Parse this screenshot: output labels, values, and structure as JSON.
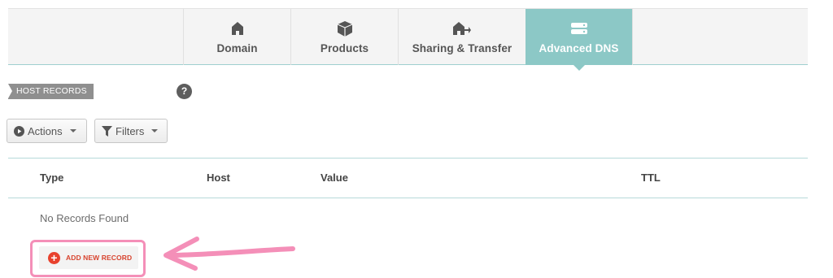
{
  "tabs": [
    {
      "label": "Domain",
      "icon": "home-icon",
      "active": false
    },
    {
      "label": "Products",
      "icon": "box-icon",
      "active": false
    },
    {
      "label": "Sharing & Transfer",
      "icon": "home-share-icon",
      "active": false
    },
    {
      "label": "Advanced DNS",
      "icon": "server-icon",
      "active": true
    }
  ],
  "section": {
    "label": "HOST RECORDS",
    "help": "?"
  },
  "toolbar": {
    "actions_label": "Actions",
    "filters_label": "Filters"
  },
  "table": {
    "columns": [
      "Type",
      "Host",
      "Value",
      "TTL"
    ],
    "empty_text": "No Records Found"
  },
  "add_record": {
    "label": "ADD NEW RECORD"
  },
  "colors": {
    "active_tab": "#8cc8c6",
    "add_button_text": "#d8442f",
    "highlight": "#f48fb8"
  }
}
